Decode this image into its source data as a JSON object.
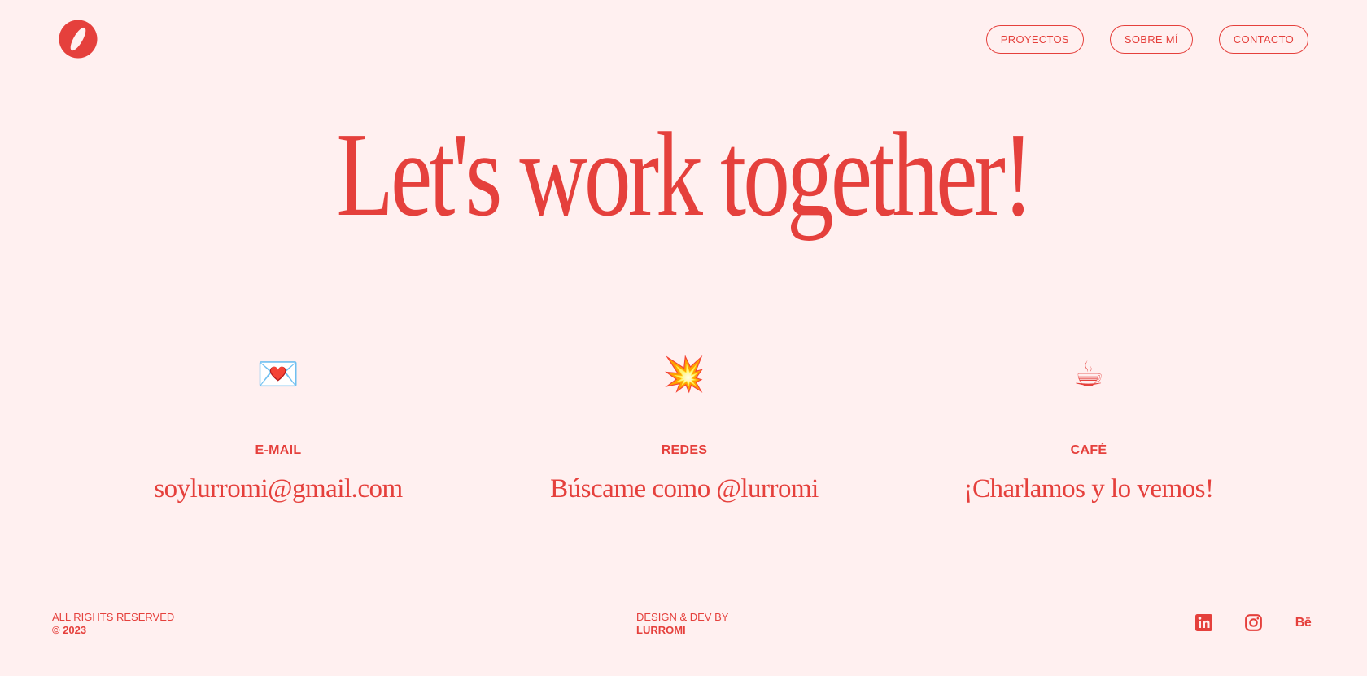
{
  "header": {
    "logo_icon": "red-o-logo-icon",
    "nav": [
      {
        "label": "PROYECTOS"
      },
      {
        "label": "SOBRE MÍ"
      },
      {
        "label": "CONTACTO"
      }
    ]
  },
  "hero": {
    "title": "Let's work together!"
  },
  "contact": [
    {
      "icon": "love-letter-icon",
      "emoji": "💌",
      "title": "E-MAIL",
      "text": "soylurromi@gmail.com"
    },
    {
      "icon": "collision-icon",
      "emoji": "💥",
      "title": "REDES",
      "text": "Búscame como @lurromi"
    },
    {
      "icon": "coffee-icon",
      "emoji": "☕",
      "title": "CAFÉ",
      "text": "¡Charlamos y lo vemos!"
    }
  ],
  "footer": {
    "rights": "ALL RIGHTS RESERVED",
    "year": "© 2023",
    "credit_label": "DESIGN & DEV BY",
    "credit_name": "LURROMI",
    "socials": [
      {
        "icon": "linkedin-icon"
      },
      {
        "icon": "instagram-icon"
      },
      {
        "icon": "behance-icon",
        "text": "Bē"
      }
    ]
  },
  "colors": {
    "background": "#fff0f0",
    "accent": "#e5403c"
  }
}
